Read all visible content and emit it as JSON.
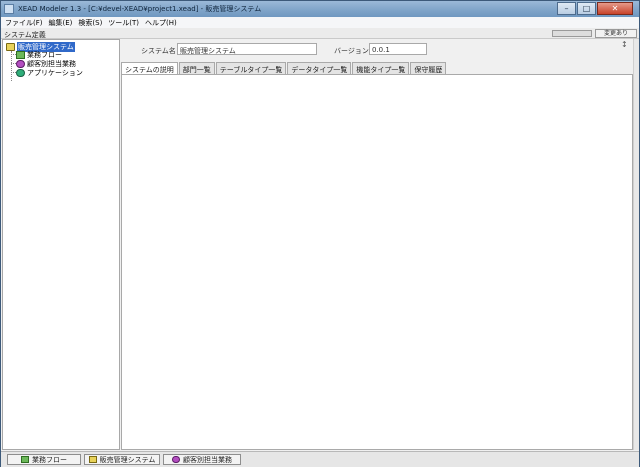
{
  "window": {
    "title": "XEAD Modeler 1.3 - [C:¥devel-XEAD¥project1.xead] - 販売管理システム"
  },
  "menu": [
    "ファイル(F)",
    "編集(E)",
    "検索(S)",
    "ツール(T)",
    "ヘルプ(H)"
  ],
  "header": {
    "label": "システム定義",
    "changed": "変更あり"
  },
  "tree": {
    "root": "販売管理システム",
    "children": [
      "業務フロー",
      "顧客別担当業務",
      "アプリケーション"
    ]
  },
  "form": {
    "system_name_label": "システム名",
    "system_name_value": "販売管理システム",
    "version_label": "バージョン",
    "version_value": "0.0.1"
  },
  "tabs": [
    "システムの説明",
    "部門一覧",
    "テーブルタイプ一覧",
    "データタイプ一覧",
    "機能タイプ一覧",
    "保守履歴"
  ],
  "bottom_tabs": [
    "業務フロー",
    "販売管理システム",
    "顧客別担当業務"
  ],
  "colors": {
    "titlebar": "#7ea3c8",
    "selection": "#3069c9",
    "close_button": "#c8432b"
  }
}
